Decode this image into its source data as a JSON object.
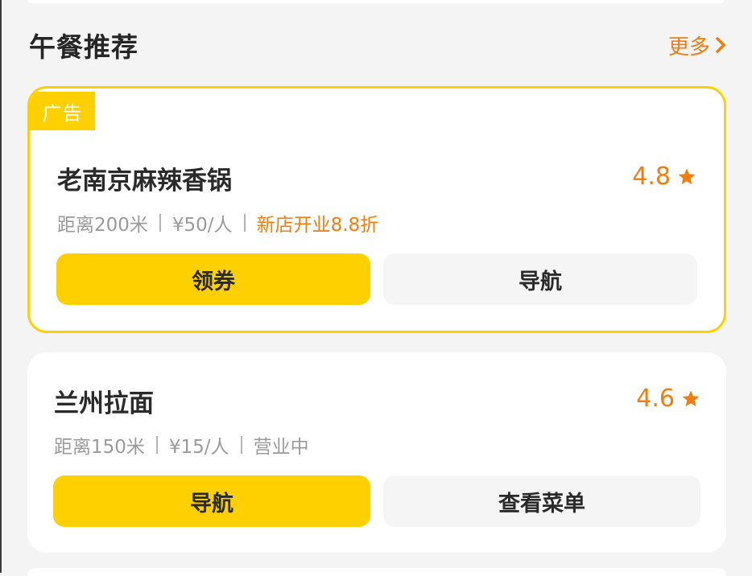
{
  "section": {
    "title": "午餐推荐",
    "more_label": "更多"
  },
  "cards": [
    {
      "badge": "广告",
      "name": "老南京麻辣香锅",
      "rating": "4.8",
      "distance": "距离200米",
      "price": "¥50/人",
      "promo": "新店开业8.8折",
      "primary_button": "领券",
      "secondary_button": "导航"
    },
    {
      "name": "兰州拉面",
      "rating": "4.6",
      "distance": "距离150米",
      "price": "¥15/人",
      "status": "营业中",
      "primary_button": "导航",
      "secondary_button": "查看菜单"
    }
  ],
  "icons": {
    "more": "chevron-right-icon",
    "rating": "star-icon"
  },
  "colors": {
    "accent_yellow": "#ffd000",
    "accent_orange": "#ef7d10",
    "button_grey": "#f5f5f5"
  }
}
